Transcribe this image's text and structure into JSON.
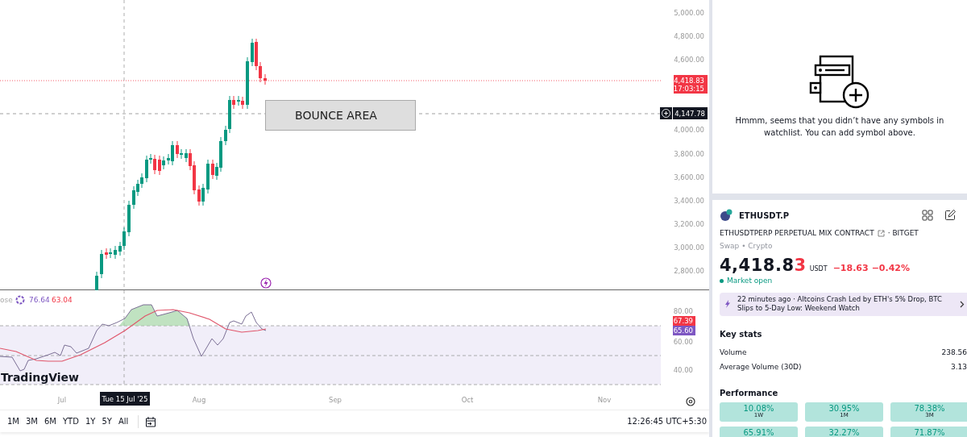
{
  "chart": {
    "price_axis": [
      "5,000.00",
      "4,800.00",
      "4,600.00",
      "4,000.00",
      "3,800.00",
      "3,600.00",
      "3,400.00",
      "3,200.00",
      "3,000.00",
      "2,800.00"
    ],
    "last_price_badge": {
      "price": "4,418.83",
      "countdown": "17:03:15"
    },
    "crosshair_price_badge": "4,147.78",
    "annotation": "BOUNCE AREA",
    "indicator": {
      "legend_label": "ose",
      "value_1": "76.64",
      "value_2": "63.04",
      "axis": [
        "80.00",
        "60.00",
        "40.00"
      ],
      "badges": [
        {
          "value": "67.39",
          "color": "#f23645"
        },
        {
          "value": "65.60",
          "color": "#7e57c2"
        }
      ]
    },
    "logo": "TradingView",
    "time_axis": [
      "Jul",
      "Aug",
      "Sep",
      "Oct",
      "Nov"
    ],
    "crosshair_date": "Tue 15 Jul '25"
  },
  "range_bar": {
    "ranges": [
      "1M",
      "3M",
      "6M",
      "YTD",
      "1Y",
      "5Y",
      "All"
    ],
    "time": "12:26:45 UTC+5:30"
  },
  "watchlist": {
    "empty_message": "Hmmm, seems that you didn’t have any symbols in watchlist. You can add symbol above."
  },
  "symbol": {
    "ticker": "ETHUSDT.P",
    "description": "ETHUSDTPERP PERPETUAL MIX CONTRACT",
    "exchange": "· BITGET",
    "category": "Swap • Crypto",
    "price_main": "4,418.8",
    "price_last_digit": "3",
    "currency": "USDT",
    "change": "−18.63",
    "change_percent": "−0.42%",
    "market_status": "Market open",
    "news": "22 minutes ago · Altcoins Crash Led by ETH's 5% Drop, BTC Slips to 5-Day Low: Weekend Watch",
    "key_stats_title": "Key stats",
    "key_stats": [
      {
        "label": "Volume",
        "value": "238.56"
      },
      {
        "label": "Average Volume (30D)",
        "value": "3.13"
      }
    ],
    "performance_title": "Performance",
    "performance": [
      {
        "value": "10.08%",
        "period": "1W"
      },
      {
        "value": "30.95%",
        "period": "1M"
      },
      {
        "value": "78.38%",
        "period": "3M"
      },
      {
        "value": "65.91%"
      },
      {
        "value": "32.27%"
      },
      {
        "value": "71.87%"
      }
    ]
  }
}
